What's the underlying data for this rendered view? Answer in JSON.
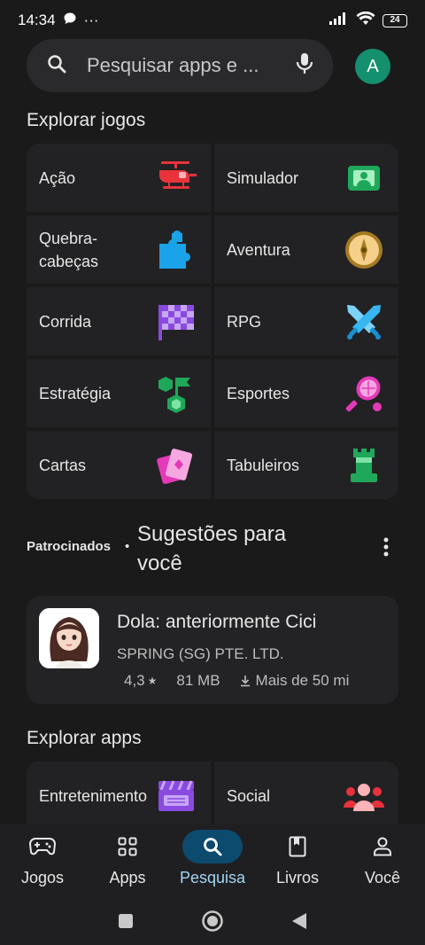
{
  "status": {
    "time": "14:34",
    "battery": "24",
    "dots": "···"
  },
  "search": {
    "placeholder": "Pesquisar apps e ...",
    "avatar_letter": "A"
  },
  "games_section": {
    "title": "Explorar jogos",
    "categories": [
      {
        "label": "Ação",
        "icon": "helicopter-icon"
      },
      {
        "label": "Simulador",
        "icon": "simulator-icon"
      },
      {
        "label": "Quebra-cabeças",
        "icon": "puzzle-icon"
      },
      {
        "label": "Aventura",
        "icon": "compass-icon"
      },
      {
        "label": "Corrida",
        "icon": "racing-flag-icon"
      },
      {
        "label": "RPG",
        "icon": "crossed-swords-icon"
      },
      {
        "label": "Estratégia",
        "icon": "strategy-icon"
      },
      {
        "label": "Esportes",
        "icon": "tennis-racket-icon"
      },
      {
        "label": "Cartas",
        "icon": "cards-icon"
      },
      {
        "label": "Tabuleiros",
        "icon": "chess-rook-icon"
      }
    ]
  },
  "sponsored": {
    "label": "Patrocinados",
    "dot": "•",
    "title": "Sugestões para você",
    "app": {
      "name": "Dola: anteriormente Cici",
      "developer": "SPRING (SG) PTE. LTD.",
      "rating": "4,3",
      "size": "81 MB",
      "downloads": "Mais de 50 mi"
    }
  },
  "apps_section": {
    "title": "Explorar apps",
    "categories": [
      {
        "label": "Entretenimento",
        "icon": "clapperboard-icon"
      },
      {
        "label": "Social",
        "icon": "people-icon"
      }
    ]
  },
  "bottom_nav": [
    {
      "label": "Jogos",
      "icon": "gamepad-icon",
      "active": false
    },
    {
      "label": "Apps",
      "icon": "apps-grid-icon",
      "active": false
    },
    {
      "label": "Pesquisa",
      "icon": "search-icon",
      "active": true
    },
    {
      "label": "Livros",
      "icon": "book-icon",
      "active": false
    },
    {
      "label": "Você",
      "icon": "person-icon",
      "active": false
    }
  ],
  "colors": {
    "background": "#1a1a1b",
    "tile": "#222224",
    "active_nav_pill": "#0c4a6e",
    "active_nav_label": "#a3d4f5",
    "avatar": "#14906f"
  }
}
